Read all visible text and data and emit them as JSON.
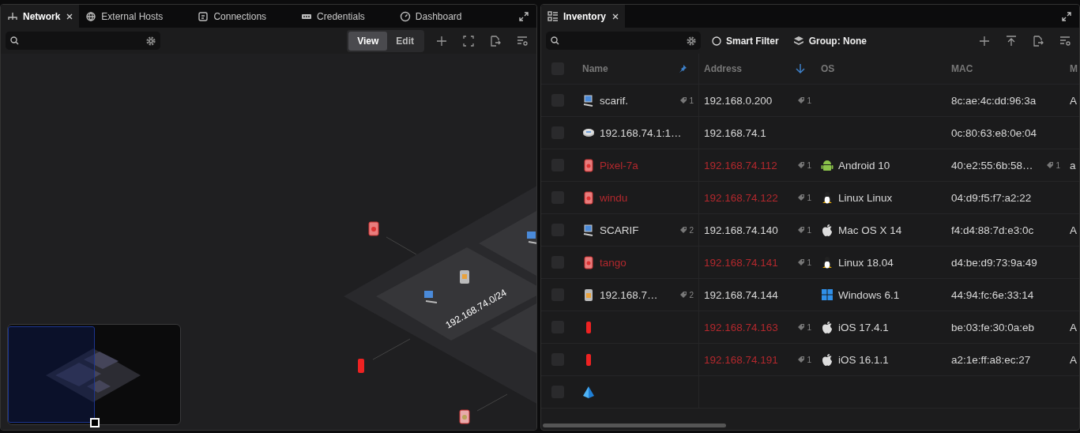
{
  "network": {
    "tabs": [
      {
        "label": "Network",
        "kind": "network",
        "selected": true,
        "closable": true
      },
      {
        "label": "External Hosts",
        "kind": "globe",
        "selected": false,
        "closable": false
      },
      {
        "label": "Connections",
        "kind": "note",
        "selected": false,
        "closable": false
      },
      {
        "label": "Credentials",
        "kind": "keycard",
        "selected": false,
        "closable": false
      },
      {
        "label": "Dashboard",
        "kind": "gauge",
        "selected": false,
        "closable": false
      }
    ],
    "modes": [
      {
        "label": "View",
        "selected": true
      },
      {
        "label": "Edit",
        "selected": false
      }
    ],
    "map": {
      "subnet_label": "192.168.74.0/24"
    }
  },
  "inventory": {
    "tabs": [
      {
        "label": "Inventory",
        "selected": true,
        "closable": true
      }
    ],
    "smart_filter": {
      "label": "Smart Filter",
      "checked": false
    },
    "group": {
      "label": "Group: None"
    },
    "select_all": {
      "checked": false
    },
    "columns": [
      {
        "label": "Name",
        "pinned": true,
        "sorted": false
      },
      {
        "label": "Address",
        "pinned": false,
        "sorted": true
      },
      {
        "label": "OS",
        "pinned": false,
        "sorted": false
      },
      {
        "label": "MAC",
        "pinned": false,
        "sorted": false
      },
      {
        "label": "M"
      }
    ],
    "rows": [
      {
        "checked": false,
        "flagged": false,
        "device": {
          "kind": "desktop",
          "text": "scarif."
        },
        "name_tags": "1",
        "address": "192.168.0.200",
        "address_tags": "1",
        "mac": "8c:ae:4c:dd:96:3a",
        "column_5": "A"
      },
      {
        "checked": false,
        "flagged": false,
        "device": {
          "kind": "router",
          "text": "192.168.74.1:1…"
        },
        "address": "192.168.74.1",
        "mac": "0c:80:63:e8:0e:04"
      },
      {
        "checked": false,
        "flagged": true,
        "device": {
          "kind": "tower",
          "text": "Pixel-7a"
        },
        "address": "192.168.74.112",
        "address_tags": "1",
        "os": {
          "kind": "android",
          "text": "Android 10"
        },
        "mac": "40:e2:55:6b:58…",
        "mac_tags": "1",
        "column_5": "a"
      },
      {
        "checked": false,
        "flagged": true,
        "device": {
          "kind": "tower",
          "text": "windu"
        },
        "address": "192.168.74.122",
        "address_tags": "1",
        "os": {
          "kind": "linux",
          "text": "Linux Linux"
        },
        "mac": "04:d9:f5:f7:a2:22"
      },
      {
        "checked": false,
        "flagged": false,
        "device": {
          "kind": "desktop",
          "text": "SCARIF"
        },
        "name_tags": "2",
        "address": "192.168.74.140",
        "address_tags": "1",
        "os": {
          "kind": "apple",
          "text": "Mac OS X 14"
        },
        "mac": "f4:d4:88:7d:e3:0c",
        "column_5": "A"
      },
      {
        "checked": false,
        "flagged": true,
        "device": {
          "kind": "tower",
          "text": "tango"
        },
        "address": "192.168.74.141",
        "address_tags": "1",
        "os": {
          "kind": "linux",
          "text": "Linux 18.04"
        },
        "mac": "d4:be:d9:73:9a:49"
      },
      {
        "checked": false,
        "flagged": false,
        "device": {
          "kind": "tower",
          "text": "192.168.7…"
        },
        "name_tags": "2",
        "address": "192.168.74.144",
        "os": {
          "kind": "windows",
          "text": "Windows 6.1"
        },
        "mac": "44:94:fc:6e:33:14"
      },
      {
        "checked": false,
        "flagged": true,
        "device": {
          "kind": "phone"
        },
        "address": "192.168.74.163",
        "address_tags": "1",
        "os": {
          "kind": "apple",
          "text": "iOS 17.4.1"
        },
        "mac": "be:03:fe:30:0a:eb",
        "column_5": "A"
      },
      {
        "checked": false,
        "flagged": true,
        "device": {
          "kind": "phone"
        },
        "address": "192.168.74.191",
        "address_tags": "1",
        "os": {
          "kind": "apple",
          "text": "iOS 16.1.1"
        },
        "mac": "a2:1e:ff:a8:ec:27",
        "column_5": "A"
      },
      {
        "checked": false,
        "device": {
          "kind": "pyramid"
        }
      }
    ]
  }
}
